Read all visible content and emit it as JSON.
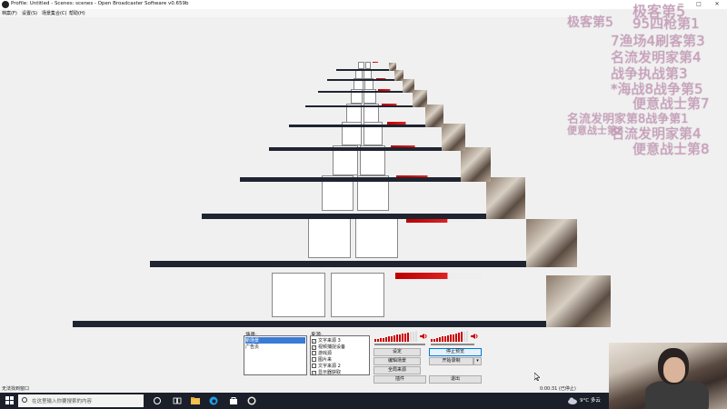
{
  "window": {
    "title": "Profile: Untitled - Scenes: scenes - Open Broadcaster Software v0.659b",
    "controls": [
      "—",
      "□",
      "✕"
    ]
  },
  "menu": [
    "档案(F)",
    "设置(S)",
    "场景集合(C)",
    "帮助(H)"
  ],
  "scenes": {
    "label": "场景:",
    "items": [
      {
        "label": "新场景",
        "selected": true
      },
      {
        "label": "广告页",
        "selected": false
      }
    ]
  },
  "sources": {
    "label": "来源:",
    "items": [
      {
        "label": "文字来源 3",
        "checked": true
      },
      {
        "label": "视频捕捉设备",
        "checked": true
      },
      {
        "label": "游戏源",
        "checked": false
      },
      {
        "label": "图片来",
        "checked": false
      },
      {
        "label": "文字来源 2",
        "checked": false
      },
      {
        "label": "显示器获取",
        "checked": true
      }
    ]
  },
  "controls": {
    "settings": "设定",
    "stop_preview": "停止预览",
    "edit_scene": "编辑场景",
    "start_record": "开始录制",
    "global_sources": "全局来源",
    "plugins": "插件",
    "exit": "退出",
    "record_dropdown": "▾"
  },
  "audio": {
    "mic_level": 0.82,
    "desktop_level": 0.88
  },
  "status": {
    "left": "无法找到窗口",
    "time": "0:00:31 (已停止)"
  },
  "taskbar": {
    "search_placeholder": "在这里输入你要搜索的内容",
    "weather": "9°C 多云",
    "icons": [
      "task-view-icon",
      "file-explorer-icon",
      "edge-icon",
      "store-icon",
      "obs-icon"
    ]
  },
  "overlay_texts": [
    "极客第5",
    "95四枪第1",
    "7渔场4刷客第3",
    "名流发明家第4",
    "战争执战第3",
    "*海战8战争第5",
    "便意战士第7",
    "名流发明家第8战争第1",
    "便意战士第8"
  ],
  "colors": {
    "taskbar": "#1b1f2a",
    "meter_red": "#cc0000",
    "selection": "#3a7bd5",
    "overlay_text": "#c9a2bd"
  }
}
